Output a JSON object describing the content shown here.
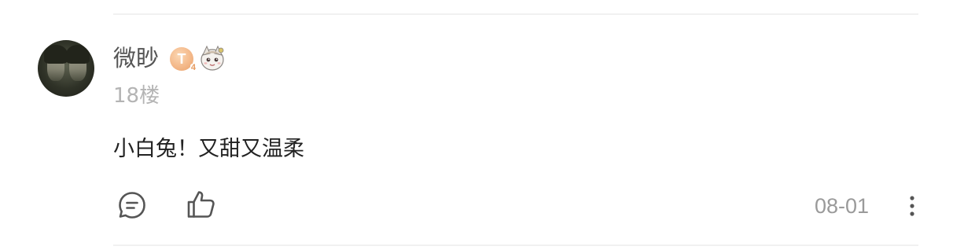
{
  "comment": {
    "user": {
      "name": "微眇",
      "level_badge": "T",
      "level_badge_sub": "4",
      "avatar_icon": "avatar-photo",
      "fan_badge_icon": "cartoon-character-badge-icon"
    },
    "floor": "18楼",
    "text": "小白兔！又甜又温柔",
    "date": "08-01",
    "actions": {
      "reply_icon": "comment-bubble-icon",
      "like_icon": "thumbs-up-icon",
      "more_icon": "more-vertical-icon"
    }
  },
  "colors": {
    "username": "#555555",
    "floor": "#b4b4b4",
    "content": "#222222",
    "date": "#9a9a9a",
    "divider": "#f1f1f1",
    "level_badge": "#f4b98a"
  }
}
